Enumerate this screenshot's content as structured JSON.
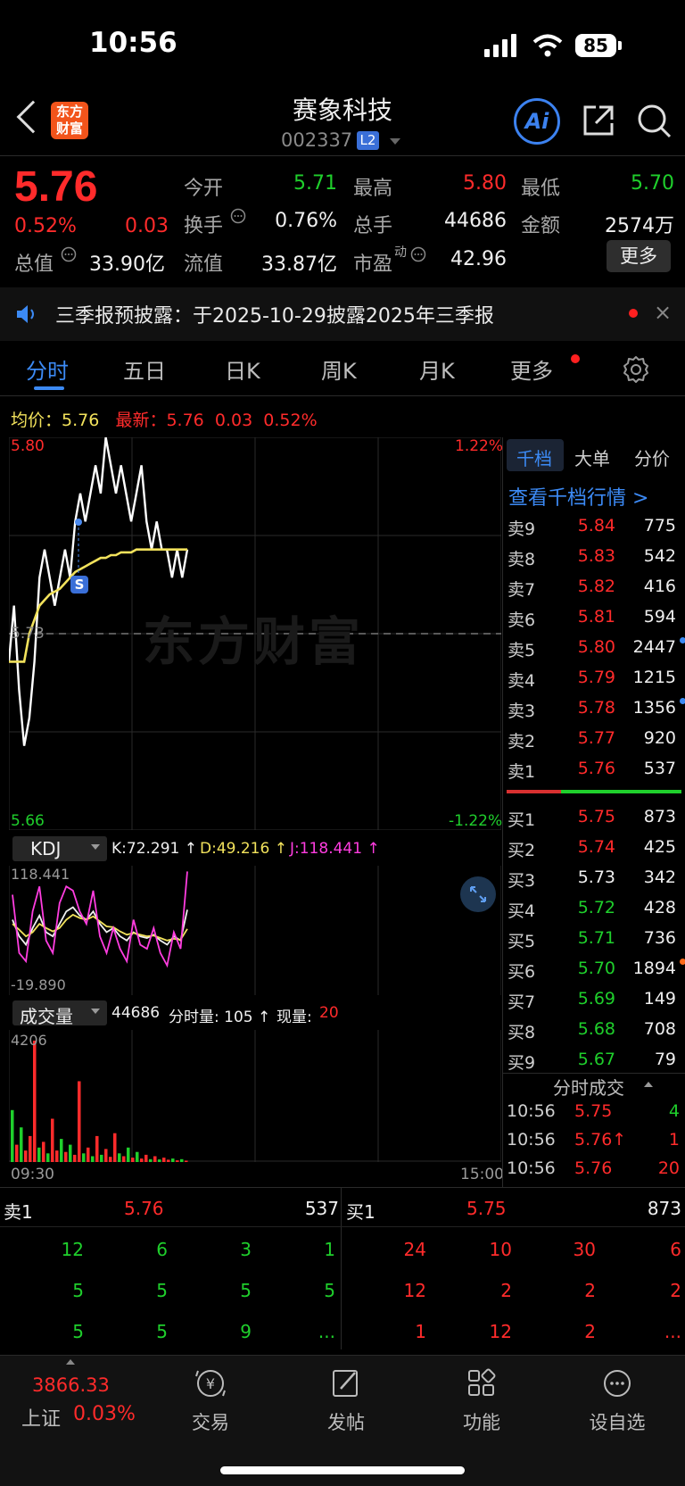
{
  "status_bar": {
    "time": "10:56",
    "battery": "85"
  },
  "header": {
    "logo_line1": "东方",
    "logo_line2": "财富",
    "stock_name": "赛象科技",
    "stock_code": "002337",
    "level_badge": "L2",
    "ai_label": "Ai"
  },
  "quote": {
    "price": "5.76",
    "change_pct": "0.52%",
    "change": "0.03",
    "open_label": "今开",
    "open": "5.71",
    "high_label": "最高",
    "high": "5.80",
    "low_label": "最低",
    "low": "5.70",
    "turnover_label": "换手",
    "turnover": "0.76%",
    "volume_label": "总手",
    "volume": "44686",
    "amount_label": "金额",
    "amount": "2574万",
    "mktcap_label": "总值",
    "mktcap": "33.90亿",
    "float_label": "流值",
    "float_cap": "33.87亿",
    "pe_label": "市盈",
    "pe_sup": "动",
    "pe": "42.96",
    "more_label": "更多"
  },
  "notice": {
    "text": "三季报预披露：于2025-10-29披露2025年三季报",
    "close": "×"
  },
  "tabs": [
    {
      "label": "分时"
    },
    {
      "label": "五日"
    },
    {
      "label": "日K"
    },
    {
      "label": "周K"
    },
    {
      "label": "月K"
    },
    {
      "label": "更多"
    }
  ],
  "chart_info": {
    "avg_label": "均价：",
    "avg": "5.76",
    "latest_label": "最新：",
    "latest": "5.76",
    "latest_change": "0.03",
    "latest_pct": "0.52%"
  },
  "chart_axes": {
    "y_high": "5.80",
    "y_mid": "5.73",
    "y_low": "5.66",
    "pct_high": "1.22%",
    "pct_low": "-1.22%",
    "watermark": "东方财富",
    "marker": "S"
  },
  "kdj": {
    "selector": "KDJ",
    "k": "K:72.291 ↑",
    "d": "D:49.216 ↑",
    "j": "J:118.441 ↑",
    "max": "118.441",
    "min": "-19.890"
  },
  "volume_panel": {
    "selector": "成交量",
    "total": "44686",
    "minute_label": "分时量: 105 ↑",
    "current_label": "现量:",
    "current": "20",
    "max": "4206",
    "start_time": "09:30",
    "end_time": "15:00"
  },
  "colors": {
    "up": "#ff2b2b",
    "down": "#1fcf2c",
    "accent": "#3c8af5",
    "price_line": "#ffffff",
    "avg_line": "#f2e25c"
  },
  "chart_data": {
    "type": "line",
    "x_range": [
      "09:30",
      "15:00"
    ],
    "ylim": [
      5.66,
      5.8
    ],
    "y2_labels": [
      "1.22%",
      "-1.22%"
    ],
    "series": [
      {
        "values": [
          5.72,
          5.74,
          5.71,
          5.69,
          5.7,
          5.72,
          5.75,
          5.76,
          5.75,
          5.74,
          5.75,
          5.76,
          5.75,
          5.77,
          5.78,
          5.77,
          5.78,
          5.79,
          5.78,
          5.8,
          5.79,
          5.78,
          5.79,
          5.78,
          5.77,
          5.78,
          5.79,
          5.77,
          5.76,
          5.77,
          5.76,
          5.76,
          5.75,
          5.76,
          5.75,
          5.76
        ]
      },
      {
        "values": [
          5.72,
          5.72,
          5.72,
          5.72,
          5.73,
          5.735,
          5.74,
          5.742,
          5.744,
          5.745,
          5.746,
          5.748,
          5.75,
          5.752,
          5.753,
          5.754,
          5.755,
          5.756,
          5.757,
          5.757,
          5.758,
          5.758,
          5.759,
          5.759,
          5.759,
          5.76,
          5.76,
          5.76,
          5.76,
          5.76,
          5.76,
          5.76,
          5.76,
          5.76,
          5.76,
          5.76
        ]
      }
    ]
  },
  "kdj_data": {
    "ylim": [
      -19.89,
      118.441
    ],
    "series": [
      {
        "values": [
          60,
          40,
          30,
          50,
          65,
          45,
          40,
          55,
          70,
          75,
          65,
          60,
          70,
          55,
          45,
          50,
          40,
          35,
          45,
          40,
          38,
          42,
          35,
          30,
          40,
          35,
          72
        ]
      },
      {
        "values": [
          55,
          48,
          40,
          45,
          55,
          50,
          46,
          50,
          60,
          66,
          62,
          60,
          64,
          58,
          52,
          51,
          46,
          42,
          44,
          42,
          40,
          41,
          38,
          35,
          37,
          36,
          49
        ]
      },
      {
        "values": [
          90,
          20,
          10,
          70,
          100,
          35,
          20,
          80,
          100,
          95,
          70,
          55,
          95,
          40,
          20,
          50,
          25,
          10,
          60,
          30,
          25,
          50,
          20,
          5,
          45,
          25,
          118
        ]
      }
    ]
  },
  "volume_data": {
    "max": 4206,
    "bars": [
      1800,
      600,
      1200,
      400,
      900,
      4206,
      500,
      700,
      300,
      1500,
      400,
      800,
      350,
      600,
      250,
      2800,
      300,
      500,
      200,
      900,
      250,
      450,
      180,
      1000,
      300,
      200,
      500,
      150,
      350,
      120,
      250,
      100,
      200,
      90,
      150,
      80,
      120,
      60,
      100,
      50
    ],
    "directions": [
      "g",
      "r",
      "g",
      "r",
      "r",
      "r",
      "g",
      "r",
      "g",
      "r",
      "r",
      "g",
      "r",
      "g",
      "r",
      "r",
      "g",
      "r",
      "g",
      "r",
      "g",
      "r",
      "r",
      "r",
      "g",
      "r",
      "g",
      "r",
      "g",
      "r",
      "r",
      "g",
      "r",
      "g",
      "r",
      "r",
      "g",
      "r",
      "g",
      "r"
    ]
  },
  "order_book": {
    "tabs": [
      "千档",
      "大单",
      "分价"
    ],
    "view_link": "查看千档行情 >",
    "asks": [
      {
        "label": "卖9",
        "price": "5.84",
        "vol": "775",
        "c": "red"
      },
      {
        "label": "卖8",
        "price": "5.83",
        "vol": "542",
        "c": "red"
      },
      {
        "label": "卖7",
        "price": "5.82",
        "vol": "416",
        "c": "red"
      },
      {
        "label": "卖6",
        "price": "5.81",
        "vol": "594",
        "c": "red"
      },
      {
        "label": "卖5",
        "price": "5.80",
        "vol": "2447",
        "c": "red",
        "dot": "blue"
      },
      {
        "label": "卖4",
        "price": "5.79",
        "vol": "1215",
        "c": "red"
      },
      {
        "label": "卖3",
        "price": "5.78",
        "vol": "1356",
        "c": "red",
        "dot": "blue"
      },
      {
        "label": "卖2",
        "price": "5.77",
        "vol": "920",
        "c": "red"
      },
      {
        "label": "卖1",
        "price": "5.76",
        "vol": "537",
        "c": "red"
      }
    ],
    "bids": [
      {
        "label": "买1",
        "price": "5.75",
        "vol": "873",
        "c": "red"
      },
      {
        "label": "买2",
        "price": "5.74",
        "vol": "425",
        "c": "red"
      },
      {
        "label": "买3",
        "price": "5.73",
        "vol": "342",
        "c": "white"
      },
      {
        "label": "买4",
        "price": "5.72",
        "vol": "428",
        "c": "green"
      },
      {
        "label": "买5",
        "price": "5.71",
        "vol": "736",
        "c": "green"
      },
      {
        "label": "买6",
        "price": "5.70",
        "vol": "1894",
        "c": "green",
        "dot": "orange"
      },
      {
        "label": "买7",
        "price": "5.69",
        "vol": "149",
        "c": "green"
      },
      {
        "label": "买8",
        "price": "5.68",
        "vol": "708",
        "c": "green"
      },
      {
        "label": "买9",
        "price": "5.67",
        "vol": "79",
        "c": "green"
      }
    ],
    "buy_ratio": 0.31
  },
  "ticks": {
    "title": "分时成交",
    "rows": [
      {
        "time": "10:56",
        "price": "5.75",
        "vol": "4",
        "pc": "red",
        "vc": "green"
      },
      {
        "time": "10:56",
        "price": "5.76↑",
        "vol": "1",
        "pc": "red",
        "vc": "red"
      },
      {
        "time": "10:56",
        "price": "5.76",
        "vol": "20",
        "pc": "red",
        "vc": "red"
      }
    ]
  },
  "level1": {
    "ask_label": "卖1",
    "ask_price": "5.76",
    "ask_vol": "537",
    "bid_label": "买1",
    "bid_price": "5.75",
    "bid_vol": "873",
    "ask_queue": [
      [
        "12",
        "6",
        "3",
        "1"
      ],
      [
        "5",
        "5",
        "5",
        "5"
      ],
      [
        "5",
        "5",
        "9",
        "..."
      ]
    ],
    "bid_queue": [
      [
        "24",
        "10",
        "30",
        "6"
      ],
      [
        "12",
        "2",
        "2",
        "2"
      ],
      [
        "1",
        "12",
        "2",
        "..."
      ]
    ]
  },
  "bottom_nav": {
    "index_value": "3866.33",
    "index_name": "上证",
    "index_pct": "0.03%",
    "items": [
      {
        "label": "交易"
      },
      {
        "label": "发帖"
      },
      {
        "label": "功能"
      },
      {
        "label": "设自选"
      }
    ]
  }
}
